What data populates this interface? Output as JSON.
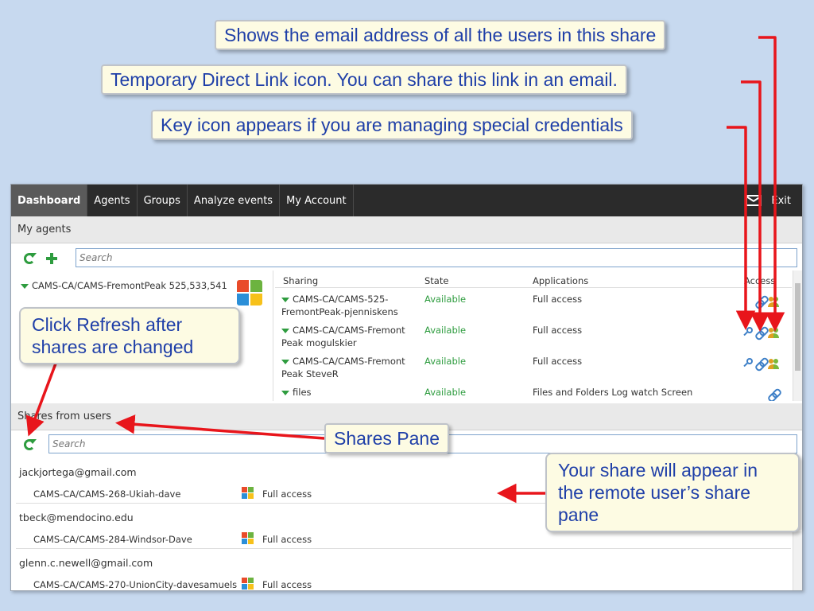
{
  "nav": {
    "tabs": [
      "Dashboard",
      "Agents",
      "Groups",
      "Analyze events",
      "My Account"
    ],
    "exit_label": "Exit"
  },
  "my_agents": {
    "header": "My agents",
    "search_placeholder": "Search",
    "agent_name": "CAMS-CA/CAMS-FremontPeak 525,533,541",
    "columns": [
      "Sharing",
      "State",
      "Applications",
      "Access"
    ],
    "rows": [
      {
        "sharing": "CAMS-CA/CAMS-525-FremontPeak-pjenniskens",
        "state": "Available",
        "applications": "Full access",
        "icons": [
          "link-icon",
          "users-icon"
        ]
      },
      {
        "sharing": "CAMS-CA/CAMS-Fremont Peak mogulskier",
        "state": "Available",
        "applications": "Full access",
        "icons": [
          "key-icon",
          "link-icon",
          "users-icon"
        ]
      },
      {
        "sharing": "CAMS-CA/CAMS-Fremont Peak SteveR",
        "state": "Available",
        "applications": "Full access",
        "icons": [
          "key-icon",
          "link-icon",
          "users-icon"
        ]
      },
      {
        "sharing": "files",
        "state": "Available",
        "applications": "Files and Folders   Log watch   Screen",
        "icons": [
          "link-icon"
        ]
      }
    ]
  },
  "shares_from_users": {
    "header": "Shares from users",
    "search_placeholder": "Search",
    "users": [
      {
        "email": "jackjortega@gmail.com",
        "share": "CAMS-CA/CAMS-268-Ukiah-dave",
        "access": "Full access"
      },
      {
        "email": "tbeck@mendocino.edu",
        "share": "CAMS-CA/CAMS-284-Windsor-Dave",
        "access": "Full access"
      },
      {
        "email": "glenn.c.newell@gmail.com",
        "share": "CAMS-CA/CAMS-270-UnionCity-davesamuels",
        "access": "Full access"
      }
    ]
  },
  "callouts": {
    "email": "Shows the email address of all the users in this share",
    "link": "Temporary Direct Link icon. You can share this link in an email.",
    "key": "Key icon appears if you are managing special credentials",
    "refresh": "Click Refresh after shares are changed",
    "shares_pane": "Shares Pane",
    "remote": "Your share will appear in the remote user’s share pane"
  },
  "colors": {
    "callout_text": "#1f3fa8",
    "arrow": "#e8151b",
    "available": "#2e9c3f"
  }
}
